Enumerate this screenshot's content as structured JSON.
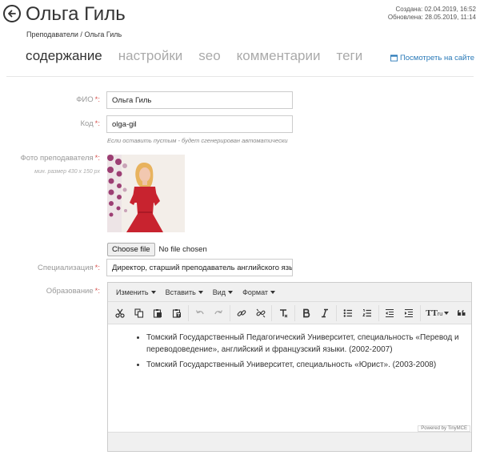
{
  "header": {
    "title": "Ольга Гиль",
    "created": "Создана: 02.04.2019, 16:52",
    "updated": "Обновлена: 28.05.2019, 11:14",
    "breadcrumb": {
      "parent": "Преподаватели",
      "separator": " / ",
      "current": "Ольга Гиль"
    }
  },
  "tabs": [
    {
      "label": "содержание",
      "active": true
    },
    {
      "label": "настройки"
    },
    {
      "label": "seo"
    },
    {
      "label": "комментарии"
    },
    {
      "label": "теги"
    }
  ],
  "view_site_label": "Посмотреть на сайте",
  "form": {
    "fio": {
      "label": "ФИО",
      "value": "Ольга Гиль"
    },
    "code": {
      "label": "Код",
      "value": "olga-gil",
      "hint": "Если оставить пустым - будет сгенерирован автоматически"
    },
    "photo": {
      "label": "Фото преподавателя",
      "sublabel": "мин. размер 430 x 150 px",
      "file_button": "Choose file",
      "file_status": "No file chosen"
    },
    "specialization": {
      "label": "Специализация",
      "value": "Директор, старший преподаватель английского языка"
    },
    "education": {
      "label": "Образование",
      "menu": [
        "Изменить",
        "Вставить",
        "Вид",
        "Формат"
      ],
      "content": [
        "Томский Государственный Педагогический Университет, специальность «Перевод и переводоведение», английский и французский языки. (2002-2007)",
        "Томский Государственный Университет, специальность «Юрист». (2003-2008)"
      ],
      "powered": "Powered by TinyMCE",
      "toolbar_textsize": "TT",
      "toolbar_textsize_sub": "ru"
    }
  },
  "colors": {
    "required": "#d9534f",
    "link": "#2a7ab8",
    "dress": "#c8232f"
  }
}
